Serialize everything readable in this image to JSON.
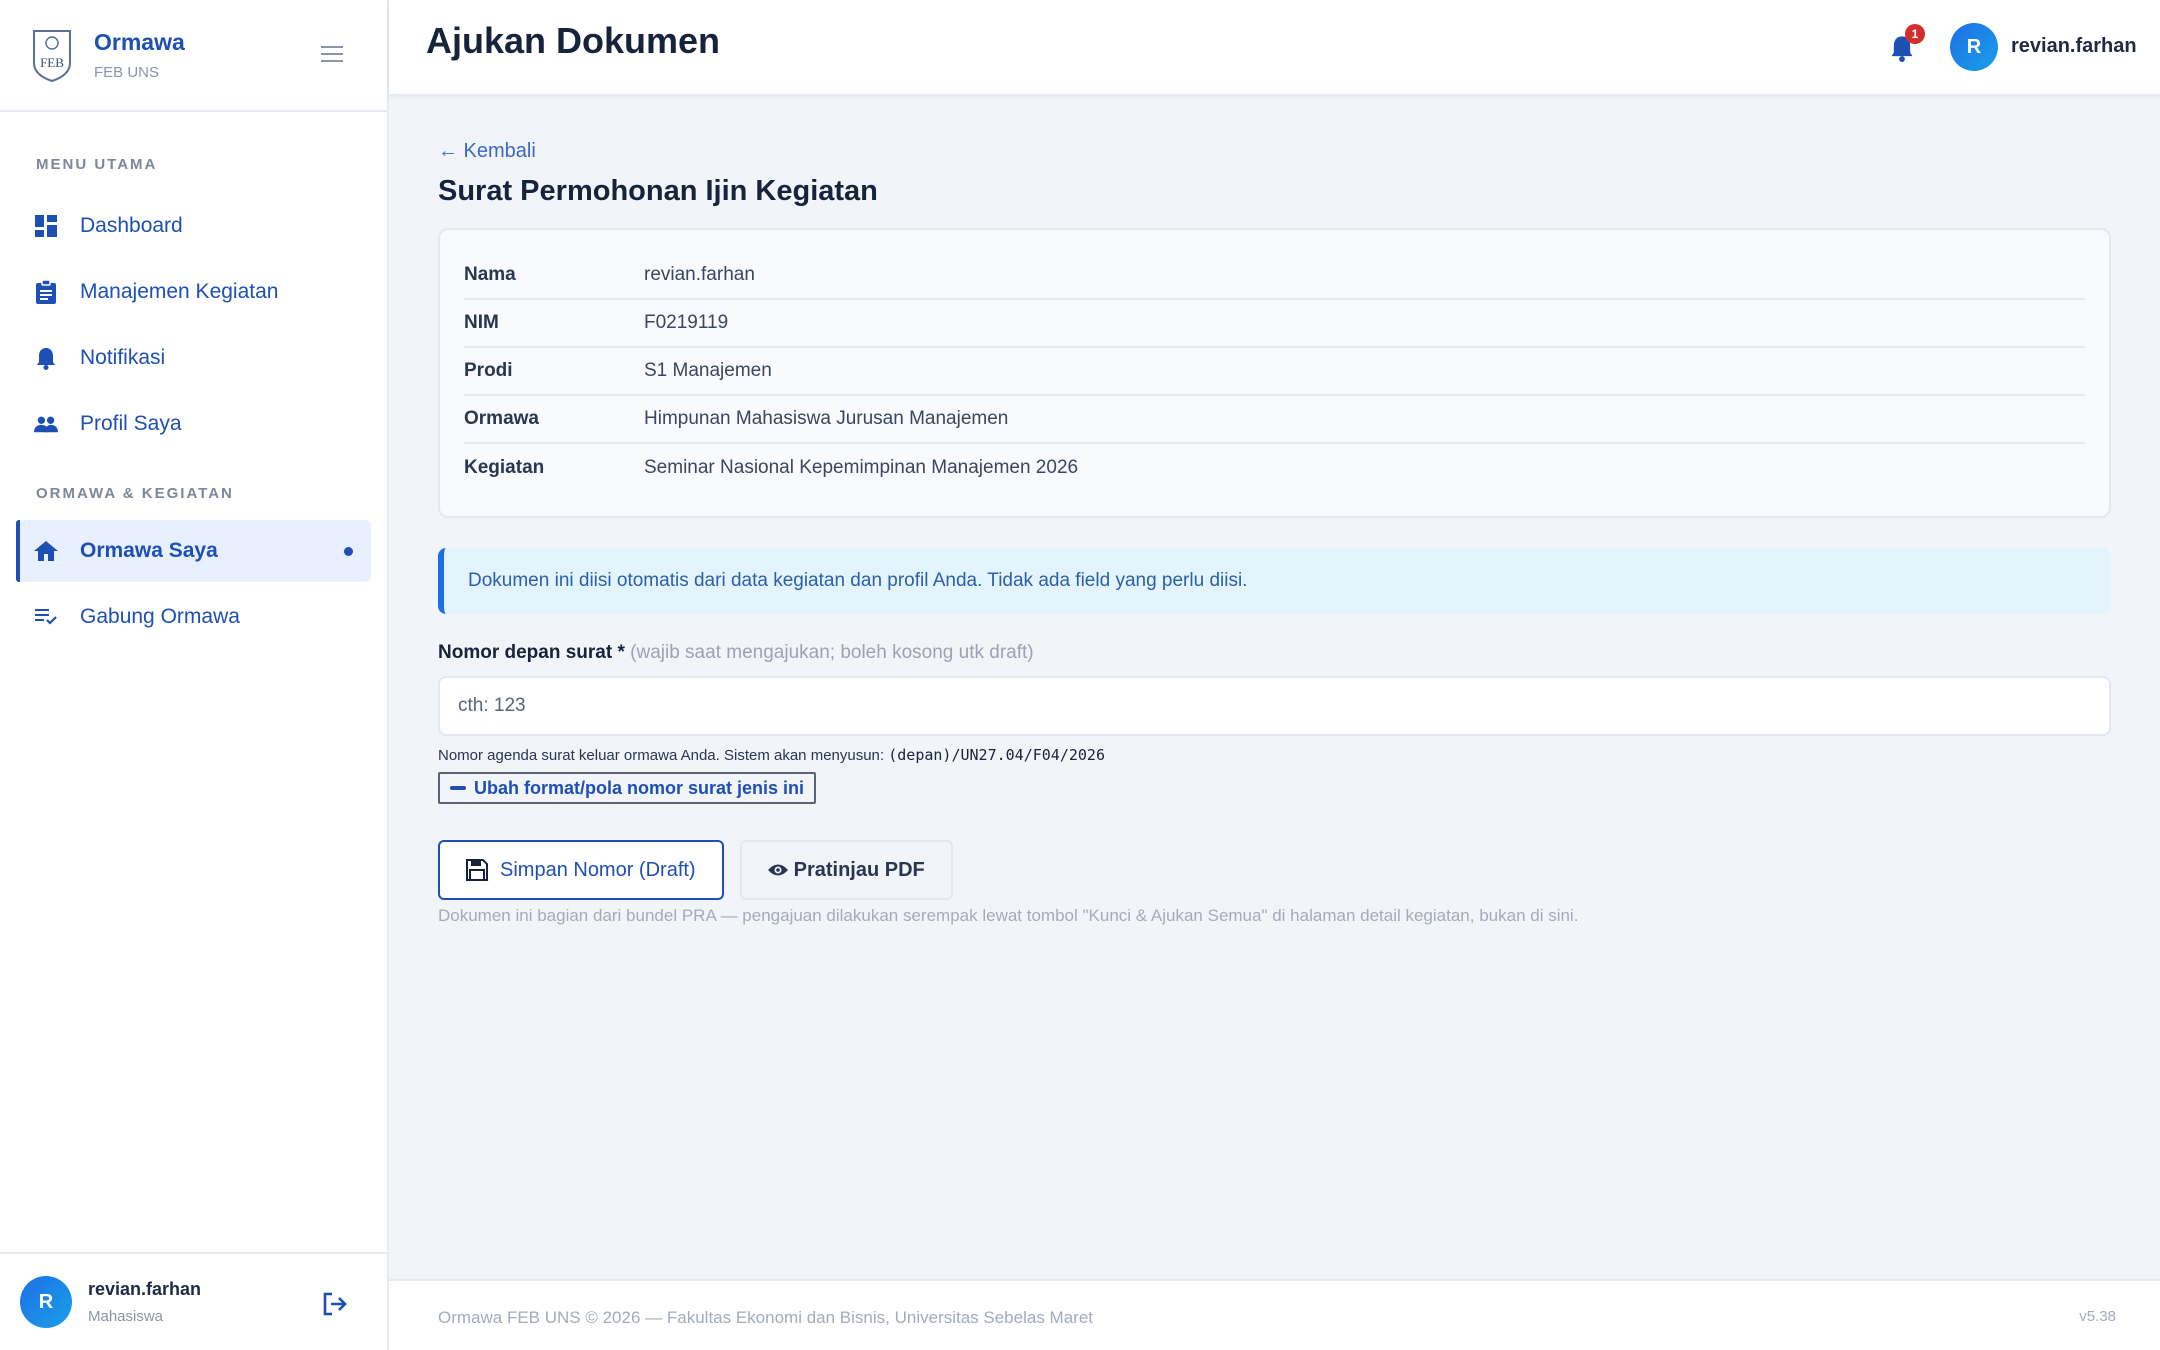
{
  "brand": {
    "title": "Ormawa",
    "subtitle": "FEB UNS",
    "logo_text": "FEB"
  },
  "sidebar": {
    "section_main": "MENU UTAMA",
    "section_org": "ORMAWA & KEGIATAN",
    "items": [
      {
        "label": "Dashboard",
        "icon": "dashboard-icon"
      },
      {
        "label": "Manajemen Kegiatan",
        "icon": "clipboard-icon"
      },
      {
        "label": "Notifikasi",
        "icon": "bell-icon"
      },
      {
        "label": "Profil Saya",
        "icon": "people-icon"
      },
      {
        "label": "Ormawa Saya",
        "icon": "home-icon",
        "active": true
      },
      {
        "label": "Gabung Ormawa",
        "icon": "playlist-add-icon"
      }
    ],
    "user": {
      "name": "revian.farhan",
      "role": "Mahasiswa",
      "initial": "R"
    }
  },
  "header": {
    "title": "Ajukan Dokumen",
    "notification_count": "1",
    "user_initial": "R",
    "user_name": "revian.farhan"
  },
  "main": {
    "back_label": "← Kembali",
    "doc_title": "Surat Permohonan Ijin Kegiatan",
    "info_rows": [
      {
        "label": "Nama",
        "value": "revian.farhan"
      },
      {
        "label": "NIM",
        "value": "F0219119"
      },
      {
        "label": "Prodi",
        "value": "S1 Manajemen"
      },
      {
        "label": "Ormawa",
        "value": "Himpunan Mahasiswa Jurusan Manajemen"
      },
      {
        "label": "Kegiatan",
        "value": "Seminar Nasional Kepemimpinan Manajemen 2026"
      }
    ],
    "alert": "Dokumen ini diisi otomatis dari data kegiatan dan profil Anda. Tidak ada field yang perlu diisi.",
    "field_label": "Nomor depan surat *",
    "field_hint": "(wajib saat mengajukan; boleh kosong utk draft)",
    "field_placeholder": "cth: 123",
    "field_value": "",
    "help_text": "Nomor agenda surat keluar ormawa Anda. Sistem akan menyusun:",
    "help_code": "(depan)/UN27.04/F04/2026",
    "format_button": "Ubah format/pola nomor surat jenis ini",
    "save_button": "Simpan Nomor (Draft)",
    "preview_button": "Pratinjau PDF",
    "note": "Dokumen ini bagian dari bundel PRA — pengajuan dilakukan serempak lewat tombol \"Kunci & Ajukan Semua\" di halaman detail kegiatan, bukan di sini."
  },
  "footer": {
    "text": "Ormawa FEB UNS © 2026 — Fakultas Ekonomi dan Bisnis, Universitas Sebelas Maret",
    "version": "v5.38"
  },
  "colors": {
    "accent": "#1d4fb5",
    "badge": "#d32f2f",
    "alert_bg": "#e3f4fd"
  }
}
